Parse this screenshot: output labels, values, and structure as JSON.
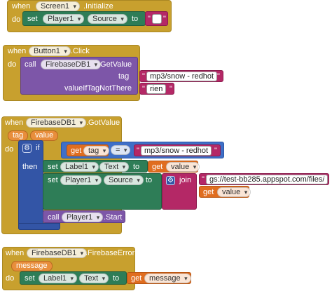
{
  "block1": {
    "when": "when",
    "component": "Screen1",
    "event": ".Initialize",
    "do": "do",
    "set": "set",
    "target": "Player1",
    "property": "Source",
    "to": "to",
    "text_value": ""
  },
  "block2": {
    "when": "when",
    "component": "Button1",
    "event": ".Click",
    "do": "do",
    "call": "call",
    "callee": "FirebaseDB1",
    "method": ".GetValue",
    "tag_label": "tag",
    "tag_value": "mp3/snow - redhot",
    "default_label": "valueIfTagNotThere",
    "default_value": "rien"
  },
  "block3": {
    "when": "when",
    "component": "FirebaseDB1",
    "event": ".GotValue",
    "param_tag": "tag",
    "param_value": "value",
    "do": "do",
    "if": "if",
    "then": "then",
    "get": "get",
    "var_tag": "tag",
    "equals": "=",
    "compare_value": "mp3/snow - redhot",
    "set": "set",
    "set1_target": "Label1",
    "set1_property": "Text",
    "to": "to",
    "var_value": "value",
    "set2_target": "Player1",
    "set2_property": "Source",
    "join": "join",
    "join_text": "gs://test-bb285.appspot.com/files/",
    "call": "call",
    "callee": "Player1",
    "method": ".Start"
  },
  "block4": {
    "when": "when",
    "component": "FirebaseDB1",
    "event": ".FirebaseError",
    "param": "message",
    "do": "do",
    "set": "set",
    "target": "Label1",
    "property": "Text",
    "to": "to",
    "get": "get",
    "var": "message"
  },
  "icons": {
    "gear": "gear-icon",
    "dropdown": "chevron-down-icon"
  },
  "colors": {
    "event": "#c8a02e",
    "set": "#2e7d57",
    "call": "#7d56a8",
    "control": "#3355a6",
    "text": "#b42866",
    "variable": "#e06d1f"
  }
}
